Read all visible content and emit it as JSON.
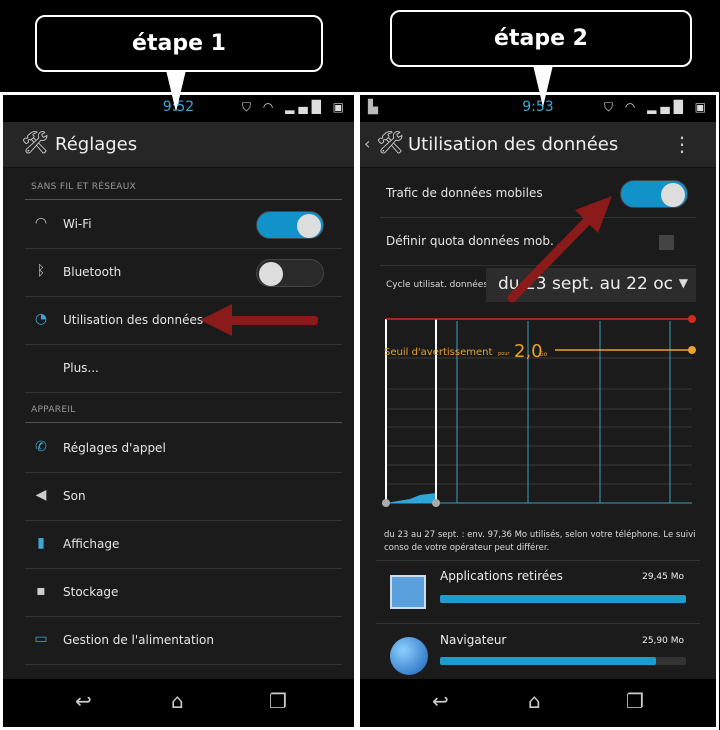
{
  "callouts": {
    "step1": "étape 1",
    "step2": "étape 2"
  },
  "left": {
    "status_time": "9:52",
    "title": "Réglages",
    "sections": [
      {
        "label": "SANS FIL ET RÉSEAUX"
      },
      {
        "label": "APPAREIL"
      }
    ],
    "items": [
      {
        "label": "Wi-Fi",
        "icon": "wifi-icon",
        "toggle": true
      },
      {
        "label": "Bluetooth",
        "icon": "bluetooth-icon",
        "toggle": false
      },
      {
        "label": "Utilisation des données",
        "icon": "data-usage-icon"
      },
      {
        "label": "Plus..."
      },
      {
        "label": "Réglages d'appel",
        "icon": "phone-icon"
      },
      {
        "label": "Son",
        "icon": "speaker-icon"
      },
      {
        "label": "Affichage",
        "icon": "display-icon"
      },
      {
        "label": "Stockage",
        "icon": "storage-icon"
      },
      {
        "label": "Gestion de l'alimentation",
        "icon": "battery-icon"
      }
    ]
  },
  "right": {
    "status_time": "9:53",
    "title": "Utilisation des données",
    "mobile_traffic": {
      "label": "Trafic de données mobiles",
      "on": true
    },
    "quota": {
      "label": "Définir quota données mob.",
      "checked": false
    },
    "cycle": {
      "label": "Cycle utilisat. données",
      "value": "du 23 sept. au 22 oc"
    },
    "warning": {
      "label": "Seuil d'avertissement",
      "unit_prefix": "pour",
      "value": "2,0",
      "unit": "Go"
    },
    "summary": "du 23 au 27 sept. : env. 97,36 Mo utilisés, selon votre téléphone. Le suivi conso de votre opérateur peut différer.",
    "apps": [
      {
        "name": "Applications retirées",
        "size": "29,45 Mo",
        "fraction": 1.0,
        "icon": "removed-apps-icon"
      },
      {
        "name": "Navigateur",
        "size": "25,90 Mo",
        "fraction": 0.88,
        "icon": "browser-globe-icon"
      }
    ]
  },
  "colors": {
    "accent": "#1e9ccd",
    "arrow": "#8b1a1a",
    "limit": "#d42a1e",
    "warning": "#e8a030"
  }
}
